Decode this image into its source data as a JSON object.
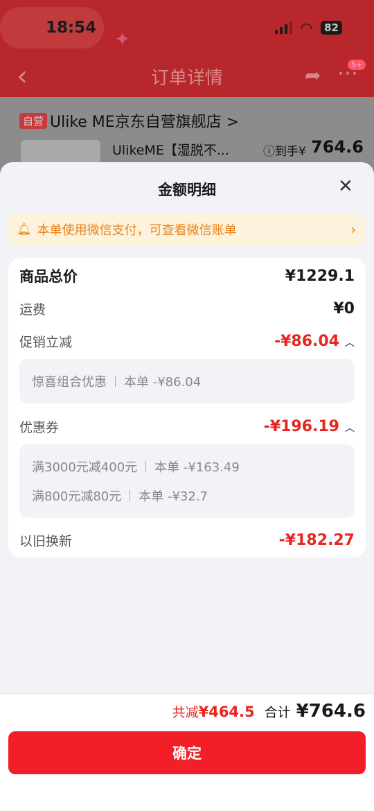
{
  "status_bar": {
    "time": "18:54",
    "battery": "82"
  },
  "nav": {
    "title": "订单详情",
    "badge": "5+"
  },
  "background_card": {
    "store_tag": "自营",
    "store_name": "Ulike ME京东自营旗舰店 >",
    "product_name": "UlikeME【湿脱不...",
    "price_label": "ⓘ到手¥",
    "price": "764.6"
  },
  "sheet": {
    "title": "金额明细",
    "notice": "本单使用微信支付，可查看微信账单",
    "rows": {
      "goods_total": {
        "label": "商品总价",
        "value": "¥1229.1"
      },
      "shipping": {
        "label": "运费",
        "value": "¥0"
      },
      "promo": {
        "label": "促销立减",
        "value": "-¥86.04",
        "details": [
          {
            "name": "惊喜组合优惠",
            "amount": "本单 -¥86.04"
          }
        ]
      },
      "coupon": {
        "label": "优惠券",
        "value": "-¥196.19",
        "details": [
          {
            "name": "满3000元减400元",
            "amount": "本单 -¥163.49"
          },
          {
            "name": "满800元减80元",
            "amount": "本单 -¥32.7"
          }
        ]
      },
      "trade_in": {
        "label": "以旧换新",
        "value": "-¥182.27"
      }
    }
  },
  "footer": {
    "saved_label": "共减",
    "saved_value": "¥464.5",
    "total_label": "合计",
    "total_value": "¥764.6",
    "confirm_label": "确定"
  },
  "colors": {
    "accent_red": "#f31f28",
    "notice_orange": "#e8841e",
    "discount_red": "#e8241e"
  }
}
